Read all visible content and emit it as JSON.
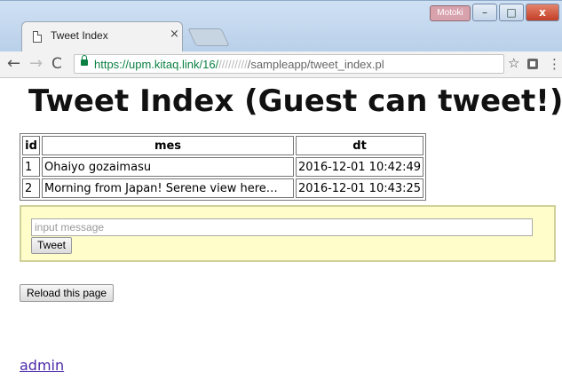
{
  "window": {
    "user_badge": "Motoki",
    "minimize": "–",
    "maximize": "□",
    "close": "x"
  },
  "tab": {
    "title": "Tweet Index",
    "close": "×"
  },
  "toolbar": {
    "back": "←",
    "forward": "→",
    "reload": "C",
    "url_origin": "https://upm.kitaq.link/16/",
    "url_blur": "/////////",
    "url_path": "/sampleapp/tweet_index.pl",
    "star": "☆",
    "menu": "⋮"
  },
  "page": {
    "title": "Tweet Index (Guest can tweet!)",
    "table": {
      "headers": [
        "id",
        "mes",
        "dt"
      ],
      "rows": [
        [
          "1",
          "Ohaiyo gozaimasu",
          "2016-12-01 10:42:49"
        ],
        [
          "2",
          "Morning from Japan! Serene view here…",
          "2016-12-01 10:43:25"
        ]
      ]
    },
    "form": {
      "placeholder": "input message",
      "value": "",
      "tweet_label": "Tweet"
    },
    "reload_label": "Reload this page",
    "admin_label": "admin"
  },
  "colors": {
    "form_bg": "#fffdc9",
    "form_border": "#cfd09a",
    "link": "#4b2aa8",
    "secure": "#0b8043"
  }
}
